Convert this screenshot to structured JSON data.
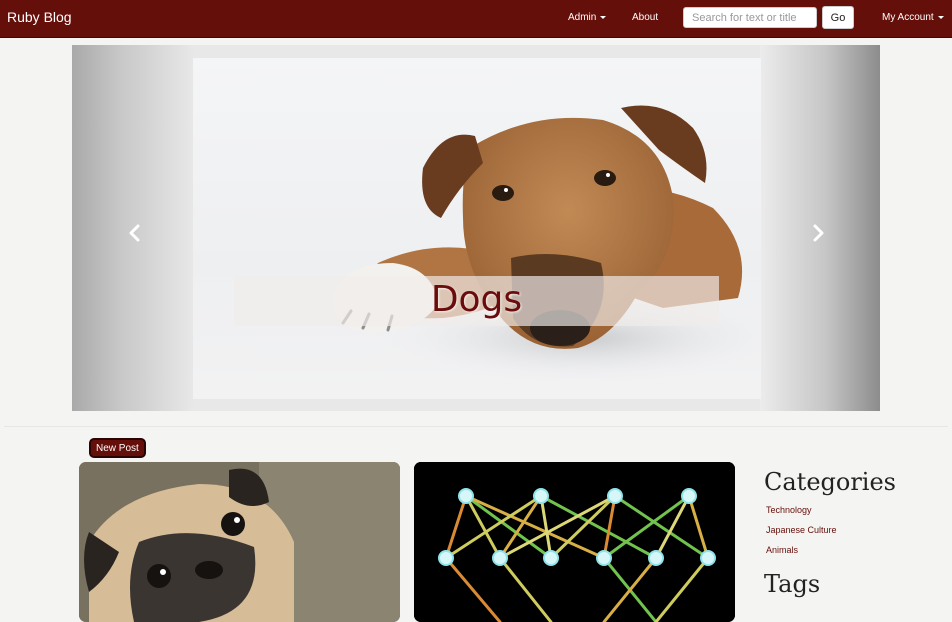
{
  "navbar": {
    "brand": "Ruby Blog",
    "admin_label": "Admin",
    "about_label": "About",
    "search_placeholder": "Search for text or title",
    "go_label": "Go",
    "account_label": "My Account"
  },
  "carousel": {
    "caption": "Dogs",
    "prev_icon": "chevron-left-icon",
    "next_icon": "chevron-right-icon"
  },
  "posts": {
    "new_post_label": "New Post"
  },
  "sidebar": {
    "categories_title": "Categories",
    "categories": [
      "Technology",
      "Japanese Culture",
      "Animals"
    ],
    "tags_title": "Tags"
  },
  "colors": {
    "navbar": "#650f0a",
    "accent": "#650f0a",
    "background": "#f4f4f2"
  }
}
